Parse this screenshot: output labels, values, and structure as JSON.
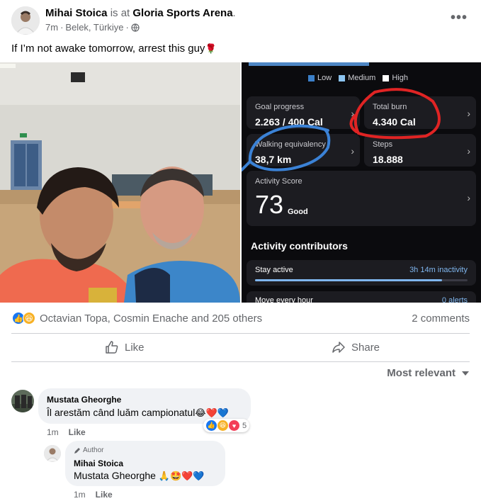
{
  "post": {
    "author": "Mihai Stoica",
    "is_at": "is at",
    "place": "Gloria Sports Arena",
    "period": ".",
    "time": "7m",
    "location": "Belek, Türkiye",
    "sep": "·",
    "text": "If I’m not awake tomorrow, arrest this guy",
    "text_emoji": "🌹",
    "more": "•••"
  },
  "screenshot": {
    "legend": [
      "Low",
      "Medium",
      "High"
    ],
    "cards": [
      {
        "label": "Goal progress",
        "value": "2.263 / 400 Cal"
      },
      {
        "label": "Total burn",
        "value": "4.340 Cal"
      },
      {
        "label": "Walking equivalency",
        "value": "38,7 km"
      },
      {
        "label": "Steps",
        "value": "18.888"
      }
    ],
    "activity_score": {
      "label": "Activity Score",
      "value": "73",
      "rating": "Good"
    },
    "contributors_title": "Activity contributors",
    "stay_active": {
      "label": "Stay active",
      "value": "3h 14m inactivity",
      "fill": 0.88
    },
    "move_hour": {
      "label": "Move every hour",
      "value": "0 alerts"
    },
    "chevron": "›"
  },
  "stats": {
    "reactors": "Octavian Topa, Cosmin Enache and 205 others",
    "comments": "2 comments"
  },
  "actions": {
    "like": "Like",
    "share": "Share"
  },
  "sort": {
    "label": "Most relevant"
  },
  "comments": [
    {
      "name": "Mustata Gheorghe",
      "text": "Îl arestăm când luăm campionatul",
      "emojis": "😂❤️💙",
      "time": "1m",
      "like": "Like",
      "react_count": "5"
    },
    {
      "badge": "Author",
      "name": "Mihai Stoica",
      "mention": "Mustata Gheorghe",
      "emojis": "🙏🤩❤️💙",
      "time": "1m",
      "like": "Like"
    }
  ],
  "colors": {
    "facebook_blue": "#1877f2",
    "meta_gray": "#65676b",
    "bubble": "#f0f2f5",
    "annotation_red": "#e02424",
    "annotation_blue": "#3b82d6"
  }
}
